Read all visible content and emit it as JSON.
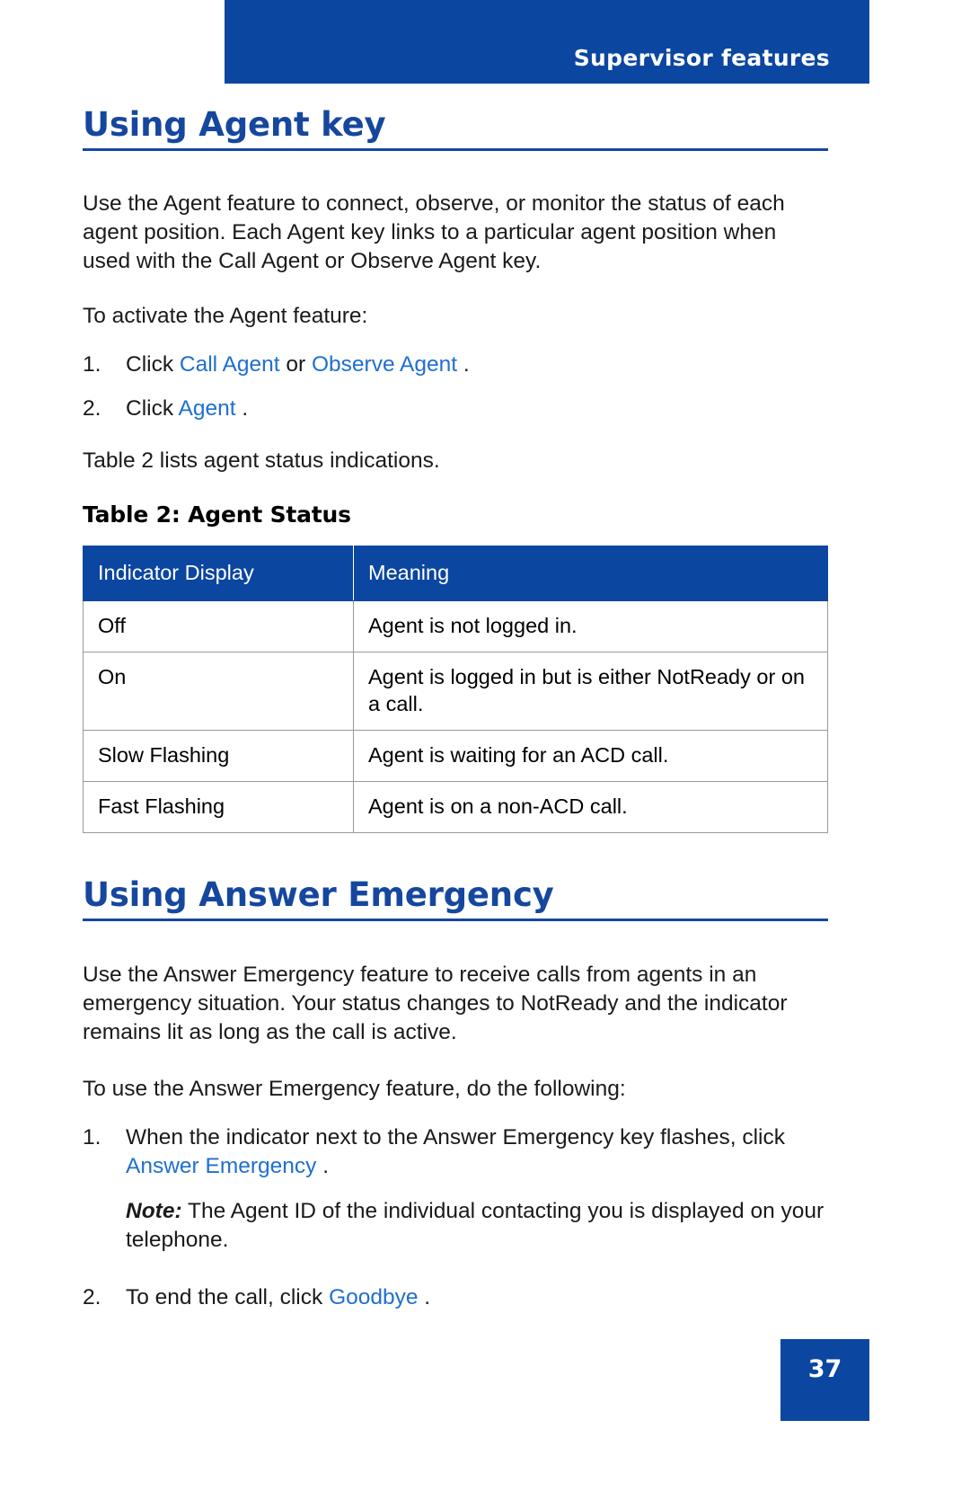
{
  "header": {
    "title": "Supervisor features",
    "bar_color": "#0b46a0"
  },
  "colors": {
    "heading_blue": "#15479e",
    "link_blue": "#1f6fd0",
    "bar_blue": "#0b46a0"
  },
  "sections": [
    {
      "heading": "Using Agent key",
      "intro": "Use the Agent feature to connect, observe, or monitor the status of each agent position. Each Agent key links to a particular agent position when used with the Call Agent or Observe Agent key.",
      "lead_in": "To activate the Agent feature:",
      "steps": [
        {
          "number": "1.",
          "before": "Click ",
          "link1": "Call Agent",
          "middle": " or ",
          "link2": "Observe Agent",
          "after": " ."
        },
        {
          "number": "2.",
          "before": "Click ",
          "link1": "Agent",
          "after": " ."
        }
      ],
      "table_lead_in": "Table 2 lists agent status indications.",
      "table": {
        "caption": "Table 2: Agent Status",
        "columns": [
          "Indicator Display",
          "Meaning"
        ],
        "rows": [
          [
            "Off",
            "Agent is not logged in."
          ],
          [
            "On",
            "Agent is logged in but is either NotReady or on a call."
          ],
          [
            "Slow Flashing",
            "Agent is waiting for an ACD call."
          ],
          [
            "Fast Flashing",
            "Agent is on a non-ACD call."
          ]
        ]
      }
    },
    {
      "heading": "Using Answer Emergency",
      "intro": "Use the Answer Emergency feature to receive calls from agents in an emergency situation. Your status changes to NotReady and the indicator remains lit as long as the call is active.",
      "lead_in": "To use the Answer Emergency feature, do the following:",
      "steps": [
        {
          "number": "1.",
          "before": "When the indicator next to the Answer Emergency key flashes, click ",
          "link1": "Answer Emergency",
          "after": " ."
        },
        {
          "number": "2.",
          "before": "To end the call, click ",
          "link1": "Goodbye",
          "after": " ."
        }
      ],
      "note": {
        "label": "Note:",
        "text": " The Agent ID of the individual contacting you is displayed on your telephone."
      }
    }
  ],
  "footer": {
    "page_number": "37"
  }
}
